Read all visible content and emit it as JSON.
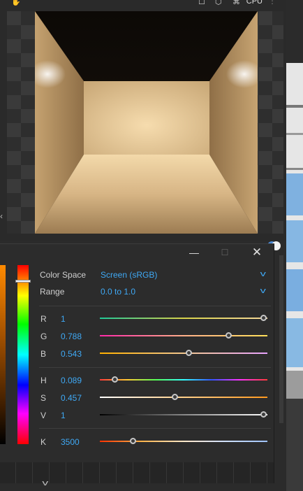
{
  "topbar": {
    "icons": [
      "hand-icon",
      "square-icon",
      "teapot-icon",
      "render-mode-icon",
      "more-icon"
    ],
    "render_device": "CPU"
  },
  "color_picker": {
    "window_buttons": {
      "minimize": "—",
      "maximize": "☐",
      "close": "✕"
    },
    "color_space_label": "Color Space",
    "color_space_value": "Screen (sRGB)",
    "range_label": "Range",
    "range_value": "0.0 to 1.0",
    "channels": [
      {
        "label": "R",
        "value": "1",
        "fraction": 1.0
      },
      {
        "label": "G",
        "value": "0.788",
        "fraction": 0.788
      },
      {
        "label": "B",
        "value": "0.543",
        "fraction": 0.543
      },
      {
        "label": "H",
        "value": "0.089",
        "fraction": 0.089
      },
      {
        "label": "S",
        "value": "0.457",
        "fraction": 0.457
      },
      {
        "label": "V",
        "value": "1",
        "fraction": 1.0
      },
      {
        "label": "K",
        "value": "3500",
        "fraction": 0.2
      }
    ],
    "hue_marker_fraction": 0.089
  }
}
